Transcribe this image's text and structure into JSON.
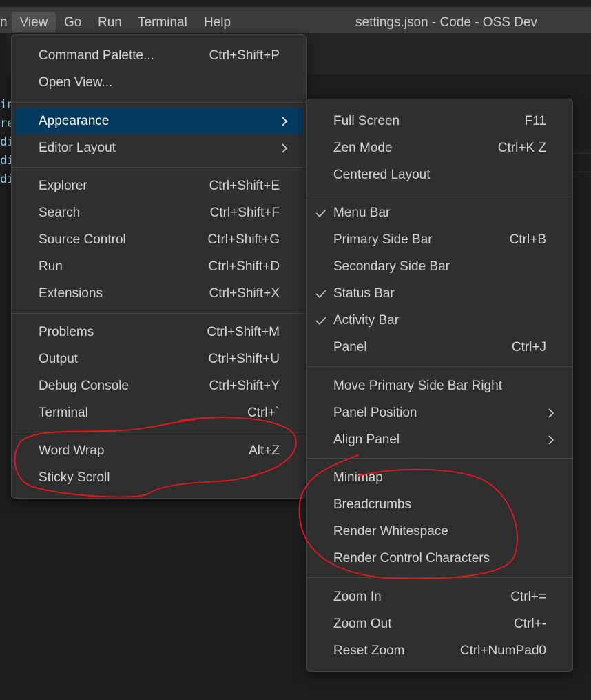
{
  "menubar": {
    "items": [
      "n",
      "View",
      "Go",
      "Run",
      "Terminal",
      "Help"
    ],
    "window_title": "settings.json - Code - OSS Dev"
  },
  "editor": {
    "lines": [
      "in",
      "re",
      "di",
      "di",
      "di"
    ],
    "line_color": "#9cdcfe"
  },
  "view_menu": {
    "items": [
      {
        "label": "Command Palette...",
        "shortcut": "Ctrl+Shift+P"
      },
      {
        "label": "Open View...",
        "shortcut": ""
      },
      {
        "label": "Appearance",
        "shortcut": "",
        "submenu": true,
        "highlighted": true
      },
      {
        "label": "Editor Layout",
        "shortcut": "",
        "submenu": true
      },
      {
        "label": "Explorer",
        "shortcut": "Ctrl+Shift+E"
      },
      {
        "label": "Search",
        "shortcut": "Ctrl+Shift+F"
      },
      {
        "label": "Source Control",
        "shortcut": "Ctrl+Shift+G"
      },
      {
        "label": "Run",
        "shortcut": "Ctrl+Shift+D"
      },
      {
        "label": "Extensions",
        "shortcut": "Ctrl+Shift+X"
      },
      {
        "label": "Problems",
        "shortcut": "Ctrl+Shift+M"
      },
      {
        "label": "Output",
        "shortcut": "Ctrl+Shift+U"
      },
      {
        "label": "Debug Console",
        "shortcut": "Ctrl+Shift+Y"
      },
      {
        "label": "Terminal",
        "shortcut": "Ctrl+`"
      },
      {
        "label": "Word Wrap",
        "shortcut": "Alt+Z"
      },
      {
        "label": "Sticky Scroll",
        "shortcut": ""
      }
    ]
  },
  "appearance_menu": {
    "items": [
      {
        "label": "Full Screen",
        "shortcut": "F11"
      },
      {
        "label": "Zen Mode",
        "shortcut": "Ctrl+K Z"
      },
      {
        "label": "Centered Layout",
        "shortcut": ""
      },
      {
        "label": "Menu Bar",
        "shortcut": "",
        "checked": true
      },
      {
        "label": "Primary Side Bar",
        "shortcut": "Ctrl+B"
      },
      {
        "label": "Secondary Side Bar",
        "shortcut": ""
      },
      {
        "label": "Status Bar",
        "shortcut": "",
        "checked": true
      },
      {
        "label": "Activity Bar",
        "shortcut": "",
        "checked": true
      },
      {
        "label": "Panel",
        "shortcut": "Ctrl+J"
      },
      {
        "label": "Move Primary Side Bar Right",
        "shortcut": ""
      },
      {
        "label": "Panel Position",
        "shortcut": "",
        "submenu": true
      },
      {
        "label": "Align Panel",
        "shortcut": "",
        "submenu": true
      },
      {
        "label": "Minimap",
        "shortcut": ""
      },
      {
        "label": "Breadcrumbs",
        "shortcut": ""
      },
      {
        "label": "Render Whitespace",
        "shortcut": ""
      },
      {
        "label": "Render Control Characters",
        "shortcut": ""
      },
      {
        "label": "Zoom In",
        "shortcut": "Ctrl+="
      },
      {
        "label": "Zoom Out",
        "shortcut": "Ctrl+-"
      },
      {
        "label": "Reset Zoom",
        "shortcut": "Ctrl+NumPad0"
      }
    ]
  },
  "colors": {
    "highlight": "#04395e",
    "menu_bg": "#2f2f2f",
    "annotation": "#e0191f"
  }
}
